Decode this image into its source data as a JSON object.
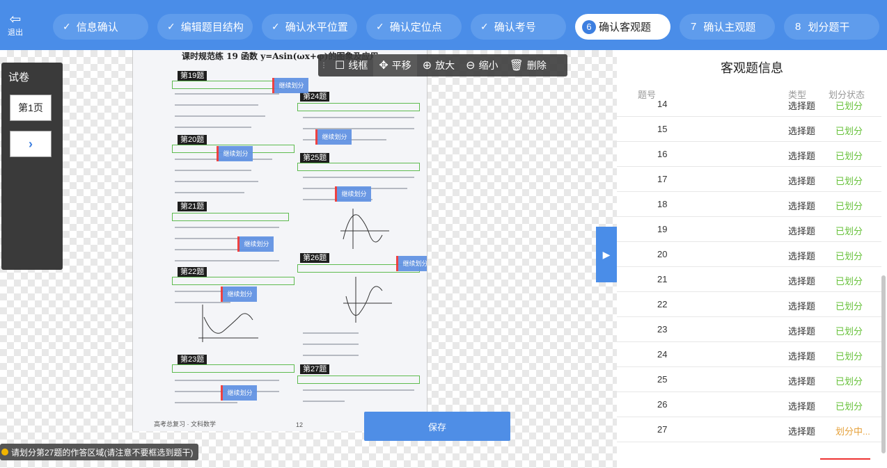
{
  "topbar": {
    "exit_label": "退出",
    "steps": [
      {
        "label": "信息确认",
        "state": "done"
      },
      {
        "label": "编辑题目结构",
        "state": "done"
      },
      {
        "label": "确认水平位置",
        "state": "done"
      },
      {
        "label": "确认定位点",
        "state": "done"
      },
      {
        "label": "确认考号",
        "state": "done"
      },
      {
        "num": "6",
        "label": "确认客观题",
        "state": "active"
      },
      {
        "num": "7",
        "label": "确认主观题",
        "state": "pending"
      },
      {
        "num": "8",
        "label": "划分题干",
        "state": "pending"
      }
    ]
  },
  "leftpanel": {
    "title": "试卷",
    "page_label": "第1页",
    "next_label": "›"
  },
  "toolbar": {
    "items": [
      {
        "icon": "square-icon",
        "label": "线框"
      },
      {
        "icon": "move-icon",
        "label": "平移"
      },
      {
        "icon": "zoom-in-icon",
        "label": "放大"
      },
      {
        "icon": "zoom-out-icon",
        "label": "缩小"
      },
      {
        "icon": "trash-icon",
        "label": "删除"
      }
    ]
  },
  "paper": {
    "title": "课时规范练 19  函数 y=Asin(ωx+φ)的图象及应用",
    "footer": "高考总复习 · 文科数学",
    "page_number": "12",
    "questions": [
      "第19题",
      "第20题",
      "第21题",
      "第22题",
      "第23题",
      "第24题",
      "第25题",
      "第26题",
      "第27题"
    ],
    "tag_label": "继续划分"
  },
  "save_label": "保存",
  "hint": "请划分第27题的作答区域(请注意不要框选到题干)",
  "rpanel": {
    "title": "客观题信息",
    "headers": {
      "num": "题号",
      "type": "类型",
      "status": "划分状态"
    },
    "rows": [
      {
        "num": "14",
        "type": "选择题",
        "status": "已划分"
      },
      {
        "num": "15",
        "type": "选择题",
        "status": "已划分"
      },
      {
        "num": "16",
        "type": "选择题",
        "status": "已划分"
      },
      {
        "num": "17",
        "type": "选择题",
        "status": "已划分"
      },
      {
        "num": "18",
        "type": "选择题",
        "status": "已划分"
      },
      {
        "num": "19",
        "type": "选择题",
        "status": "已划分"
      },
      {
        "num": "20",
        "type": "选择题",
        "status": "已划分"
      },
      {
        "num": "21",
        "type": "选择题",
        "status": "已划分"
      },
      {
        "num": "22",
        "type": "选择题",
        "status": "已划分"
      },
      {
        "num": "23",
        "type": "选择题",
        "status": "已划分"
      },
      {
        "num": "24",
        "type": "选择题",
        "status": "已划分"
      },
      {
        "num": "25",
        "type": "选择题",
        "status": "已划分"
      },
      {
        "num": "26",
        "type": "选择题",
        "status": "已划分"
      },
      {
        "num": "27",
        "type": "选择题",
        "status": "划分中..."
      }
    ]
  }
}
